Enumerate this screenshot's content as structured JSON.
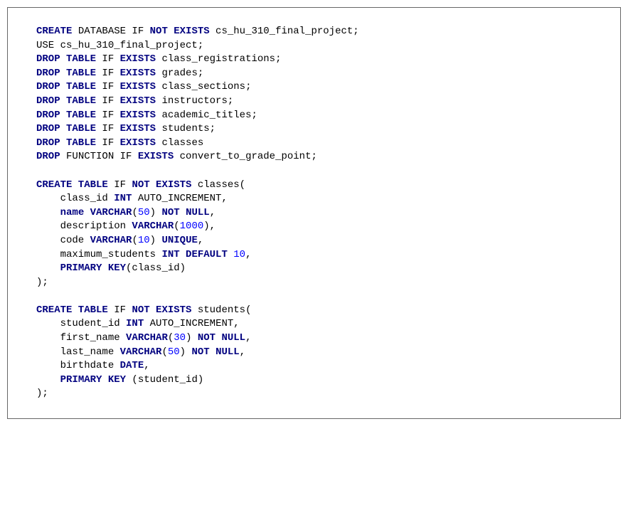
{
  "lines": [
    [
      {
        "t": "CREATE",
        "c": "kw"
      },
      {
        "t": " DATABASE IF ",
        "c": "txt"
      },
      {
        "t": "NOT EXISTS",
        "c": "kw"
      },
      {
        "t": " cs_hu_310_final_project;",
        "c": "txt"
      }
    ],
    [
      {
        "t": "USE cs_hu_310_final_project;",
        "c": "txt"
      }
    ],
    [
      {
        "t": "DROP TABLE",
        "c": "kw"
      },
      {
        "t": " IF ",
        "c": "txt"
      },
      {
        "t": "EXISTS",
        "c": "kw"
      },
      {
        "t": " class_registrations;",
        "c": "txt"
      }
    ],
    [
      {
        "t": "DROP TABLE",
        "c": "kw"
      },
      {
        "t": " IF ",
        "c": "txt"
      },
      {
        "t": "EXISTS",
        "c": "kw"
      },
      {
        "t": " grades;",
        "c": "txt"
      }
    ],
    [
      {
        "t": "DROP TABLE",
        "c": "kw"
      },
      {
        "t": " IF ",
        "c": "txt"
      },
      {
        "t": "EXISTS",
        "c": "kw"
      },
      {
        "t": " class_sections;",
        "c": "txt"
      }
    ],
    [
      {
        "t": "DROP TABLE",
        "c": "kw"
      },
      {
        "t": " IF ",
        "c": "txt"
      },
      {
        "t": "EXISTS",
        "c": "kw"
      },
      {
        "t": " instructors;",
        "c": "txt"
      }
    ],
    [
      {
        "t": "DROP TABLE",
        "c": "kw"
      },
      {
        "t": " IF ",
        "c": "txt"
      },
      {
        "t": "EXISTS",
        "c": "kw"
      },
      {
        "t": " academic_titles;",
        "c": "txt"
      }
    ],
    [
      {
        "t": "DROP TABLE",
        "c": "kw"
      },
      {
        "t": " IF ",
        "c": "txt"
      },
      {
        "t": "EXISTS",
        "c": "kw"
      },
      {
        "t": " students;",
        "c": "txt"
      }
    ],
    [
      {
        "t": "DROP TABLE",
        "c": "kw"
      },
      {
        "t": " IF ",
        "c": "txt"
      },
      {
        "t": "EXISTS",
        "c": "kw"
      },
      {
        "t": " classes",
        "c": "txt"
      }
    ],
    [
      {
        "t": "DROP",
        "c": "kw"
      },
      {
        "t": " FUNCTION IF ",
        "c": "txt"
      },
      {
        "t": "EXISTS",
        "c": "kw"
      },
      {
        "t": " convert_to_grade_point;",
        "c": "txt"
      }
    ],
    [
      {
        "t": "",
        "c": "txt"
      }
    ],
    [
      {
        "t": "CREATE TABLE",
        "c": "kw"
      },
      {
        "t": " IF ",
        "c": "txt"
      },
      {
        "t": "NOT EXISTS",
        "c": "kw"
      },
      {
        "t": " classes(",
        "c": "txt"
      }
    ],
    [
      {
        "t": "    class_id ",
        "c": "txt"
      },
      {
        "t": "INT",
        "c": "kw"
      },
      {
        "t": " AUTO_INCREMENT,",
        "c": "txt"
      }
    ],
    [
      {
        "t": "    ",
        "c": "txt"
      },
      {
        "t": "name VARCHAR",
        "c": "kw"
      },
      {
        "t": "(",
        "c": "txt"
      },
      {
        "t": "50",
        "c": "num"
      },
      {
        "t": ") ",
        "c": "txt"
      },
      {
        "t": "NOT NULL",
        "c": "kw"
      },
      {
        "t": ",",
        "c": "txt"
      }
    ],
    [
      {
        "t": "    description ",
        "c": "txt"
      },
      {
        "t": "VARCHAR",
        "c": "kw"
      },
      {
        "t": "(",
        "c": "txt"
      },
      {
        "t": "1000",
        "c": "num"
      },
      {
        "t": "),",
        "c": "txt"
      }
    ],
    [
      {
        "t": "    code ",
        "c": "txt"
      },
      {
        "t": "VARCHAR",
        "c": "kw"
      },
      {
        "t": "(",
        "c": "txt"
      },
      {
        "t": "10",
        "c": "num"
      },
      {
        "t": ") ",
        "c": "txt"
      },
      {
        "t": "UNIQUE",
        "c": "kw"
      },
      {
        "t": ",",
        "c": "txt"
      }
    ],
    [
      {
        "t": "    maximum_students ",
        "c": "txt"
      },
      {
        "t": "INT DEFAULT",
        "c": "kw"
      },
      {
        "t": " ",
        "c": "txt"
      },
      {
        "t": "10",
        "c": "num"
      },
      {
        "t": ",",
        "c": "txt"
      }
    ],
    [
      {
        "t": "    ",
        "c": "txt"
      },
      {
        "t": "PRIMARY KEY",
        "c": "kw"
      },
      {
        "t": "(class_id)",
        "c": "txt"
      }
    ],
    [
      {
        "t": ");",
        "c": "txt"
      }
    ],
    [
      {
        "t": "",
        "c": "txt"
      }
    ],
    [
      {
        "t": "CREATE TABLE",
        "c": "kw"
      },
      {
        "t": " IF ",
        "c": "txt"
      },
      {
        "t": "NOT EXISTS",
        "c": "kw"
      },
      {
        "t": " students(",
        "c": "txt"
      }
    ],
    [
      {
        "t": "    student_id ",
        "c": "txt"
      },
      {
        "t": "INT",
        "c": "kw"
      },
      {
        "t": " AUTO_INCREMENT,",
        "c": "txt"
      }
    ],
    [
      {
        "t": "    first_name ",
        "c": "txt"
      },
      {
        "t": "VARCHAR",
        "c": "kw"
      },
      {
        "t": "(",
        "c": "txt"
      },
      {
        "t": "30",
        "c": "num"
      },
      {
        "t": ") ",
        "c": "txt"
      },
      {
        "t": "NOT NULL",
        "c": "kw"
      },
      {
        "t": ",",
        "c": "txt"
      }
    ],
    [
      {
        "t": "    last_name ",
        "c": "txt"
      },
      {
        "t": "VARCHAR",
        "c": "kw"
      },
      {
        "t": "(",
        "c": "txt"
      },
      {
        "t": "50",
        "c": "num"
      },
      {
        "t": ") ",
        "c": "txt"
      },
      {
        "t": "NOT NULL",
        "c": "kw"
      },
      {
        "t": ",",
        "c": "txt"
      }
    ],
    [
      {
        "t": "    birthdate ",
        "c": "txt"
      },
      {
        "t": "DATE",
        "c": "kw"
      },
      {
        "t": ",",
        "c": "txt"
      }
    ],
    [
      {
        "t": "    ",
        "c": "txt"
      },
      {
        "t": "PRIMARY KEY",
        "c": "kw"
      },
      {
        "t": " (student_id)",
        "c": "txt"
      }
    ],
    [
      {
        "t": ");",
        "c": "txt"
      }
    ]
  ]
}
